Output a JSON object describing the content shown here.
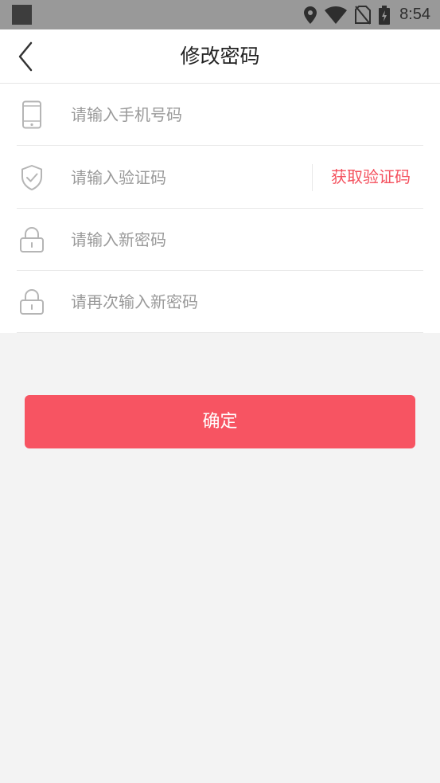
{
  "status_bar": {
    "time": "8:54",
    "icons": [
      "notification-square-icon",
      "location-icon",
      "wifi-icon",
      "no-sim-icon",
      "battery-charging-icon"
    ]
  },
  "header": {
    "title": "修改密码",
    "back_icon": "chevron-left-icon"
  },
  "form": {
    "phone": {
      "placeholder": "请输入手机号码",
      "value": "",
      "icon": "phone-icon"
    },
    "code": {
      "placeholder": "请输入验证码",
      "value": "",
      "icon": "shield-check-icon",
      "get_code_label": "获取验证码"
    },
    "new_password": {
      "placeholder": "请输入新密码",
      "value": "",
      "icon": "lock-icon"
    },
    "confirm_password": {
      "placeholder": "请再次输入新密码",
      "value": "",
      "icon": "lock-icon"
    }
  },
  "confirm_button": {
    "label": "确定"
  },
  "colors": {
    "accent": "#f75462",
    "accent_text": "#f4515e",
    "background": "#f3f3f3",
    "status_bar": "#999999"
  }
}
